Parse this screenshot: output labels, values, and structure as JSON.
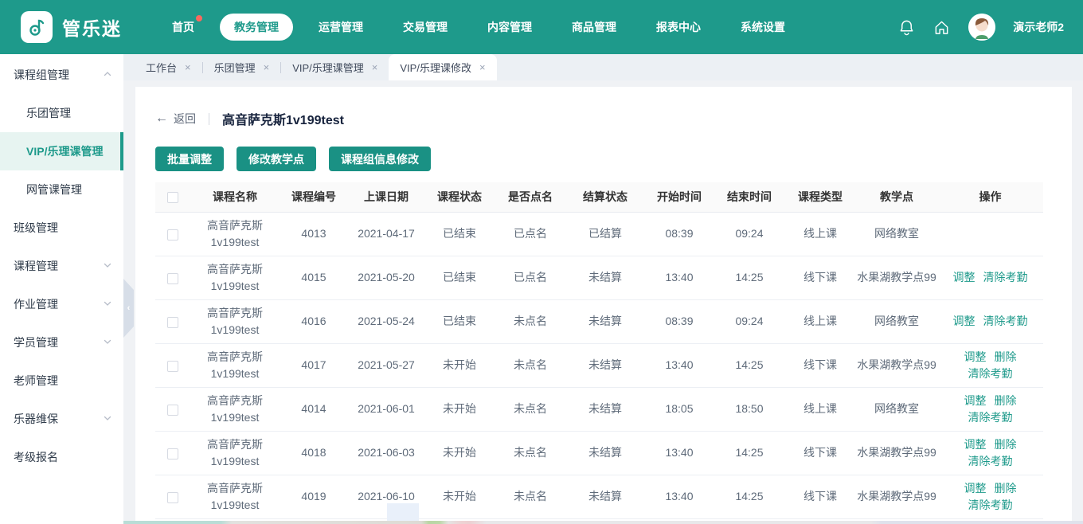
{
  "colors": {
    "accent": "#1e9a8b",
    "button": "#1a9184",
    "selected_bg": "#e7f4f1",
    "page_bg": "#f0f2f5",
    "badge": "#f9695f",
    "link": "#1e9a8b"
  },
  "brand": {
    "name": "管乐迷",
    "logo_icon": "music-note-icon"
  },
  "navbar": {
    "items": [
      {
        "label": "首页",
        "badge": true,
        "active": false
      },
      {
        "label": "教务管理",
        "badge": false,
        "active": true
      },
      {
        "label": "运营管理",
        "badge": false,
        "active": false
      },
      {
        "label": "交易管理",
        "badge": false,
        "active": false
      },
      {
        "label": "内容管理",
        "badge": false,
        "active": false
      },
      {
        "label": "商品管理",
        "badge": false,
        "active": false
      },
      {
        "label": "报表中心",
        "badge": false,
        "active": false
      },
      {
        "label": "系统设置",
        "badge": false,
        "active": false
      }
    ],
    "icons": [
      "bell-icon",
      "home-icon"
    ],
    "user": {
      "name": "演示老师2",
      "avatar": "cartoon-teacher-avatar"
    }
  },
  "sidebar": {
    "items": [
      {
        "label": "课程组管理",
        "level": 1,
        "chevron": "up",
        "active": false
      },
      {
        "label": "乐团管理",
        "level": 2,
        "chevron": "",
        "active": false
      },
      {
        "label": "VIP/乐理课管理",
        "level": 2,
        "chevron": "",
        "active": true
      },
      {
        "label": "网管课管理",
        "level": 2,
        "chevron": "",
        "active": false
      },
      {
        "label": "班级管理",
        "level": 1,
        "chevron": "",
        "active": false
      },
      {
        "label": "课程管理",
        "level": 1,
        "chevron": "down",
        "active": false
      },
      {
        "label": "作业管理",
        "level": 1,
        "chevron": "down",
        "active": false
      },
      {
        "label": "学员管理",
        "level": 1,
        "chevron": "down",
        "active": false
      },
      {
        "label": "老师管理",
        "level": 1,
        "chevron": "",
        "active": false
      },
      {
        "label": "乐器维保",
        "level": 1,
        "chevron": "down",
        "active": false
      },
      {
        "label": "考级报名",
        "level": 1,
        "chevron": "",
        "active": false
      }
    ],
    "collapse_handle": "chevron-left-icon"
  },
  "tabs": [
    {
      "label": "工作台",
      "active": false
    },
    {
      "label": "乐团管理",
      "active": false
    },
    {
      "label": "VIP/乐理课管理",
      "active": false
    },
    {
      "label": "VIP/乐理课修改",
      "active": true
    }
  ],
  "page": {
    "back_label": "返回",
    "title": "高音萨克斯1v199test",
    "buttons": [
      "批量调整",
      "修改教学点",
      "课程组信息修改"
    ]
  },
  "table": {
    "columns": [
      "课程名称",
      "课程编号",
      "上课日期",
      "课程状态",
      "是否点名",
      "结算状态",
      "开始时间",
      "结束时间",
      "课程类型",
      "教学点",
      "操作"
    ],
    "action_labels": {
      "adjust": "调整",
      "delete": "删除",
      "clear": "清除考勤"
    },
    "rows": [
      {
        "name": "高音萨克斯1v199test",
        "id": "4013",
        "date": "2021-04-17",
        "status": "已结束",
        "rollcall": "已点名",
        "settlement": "已结算",
        "start": "08:39",
        "end": "09:24",
        "type": "线上课",
        "location": "网络教室",
        "actions": []
      },
      {
        "name": "高音萨克斯1v199test",
        "id": "4015",
        "date": "2021-05-20",
        "status": "已结束",
        "rollcall": "已点名",
        "settlement": "未结算",
        "start": "13:40",
        "end": "14:25",
        "type": "线下课",
        "location": "水果湖教学点99",
        "actions": [
          "adjust",
          "clear"
        ]
      },
      {
        "name": "高音萨克斯1v199test",
        "id": "4016",
        "date": "2021-05-24",
        "status": "已结束",
        "rollcall": "未点名",
        "settlement": "未结算",
        "start": "08:39",
        "end": "09:24",
        "type": "线上课",
        "location": "网络教室",
        "actions": [
          "adjust",
          "clear"
        ]
      },
      {
        "name": "高音萨克斯1v199test",
        "id": "4017",
        "date": "2021-05-27",
        "status": "未开始",
        "rollcall": "未点名",
        "settlement": "未结算",
        "start": "13:40",
        "end": "14:25",
        "type": "线下课",
        "location": "水果湖教学点99",
        "actions": [
          "adjust",
          "delete",
          "clear"
        ]
      },
      {
        "name": "高音萨克斯1v199test",
        "id": "4014",
        "date": "2021-06-01",
        "status": "未开始",
        "rollcall": "未点名",
        "settlement": "未结算",
        "start": "18:05",
        "end": "18:50",
        "type": "线上课",
        "location": "网络教室",
        "actions": [
          "adjust",
          "delete",
          "clear"
        ]
      },
      {
        "name": "高音萨克斯1v199test",
        "id": "4018",
        "date": "2021-06-03",
        "status": "未开始",
        "rollcall": "未点名",
        "settlement": "未结算",
        "start": "13:40",
        "end": "14:25",
        "type": "线下课",
        "location": "水果湖教学点99",
        "actions": [
          "adjust",
          "delete",
          "clear"
        ]
      },
      {
        "name": "高音萨克斯1v199test",
        "id": "4019",
        "date": "2021-06-10",
        "status": "未开始",
        "rollcall": "未点名",
        "settlement": "未结算",
        "start": "13:40",
        "end": "14:25",
        "type": "线下课",
        "location": "水果湖教学点99",
        "actions": [
          "adjust",
          "delete",
          "clear"
        ]
      }
    ]
  }
}
